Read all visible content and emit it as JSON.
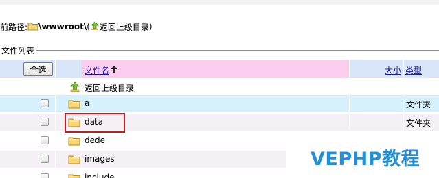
{
  "path_bar": {
    "prefix": "前路径:",
    "path": "\\wwwroot\\",
    "paren_open": "(",
    "up_link": "返回上级目录",
    "paren_close": ")"
  },
  "file_list": {
    "legend": "文件列表",
    "header": {
      "select_all": "全选",
      "name": "文件名",
      "size": "大小",
      "type": "类型"
    },
    "up_row": {
      "label": "返回上级目录"
    },
    "rows": [
      {
        "name": "a",
        "type": "文件夹"
      },
      {
        "name": "data",
        "type": "文件夹"
      },
      {
        "name": "dede",
        "type": ""
      },
      {
        "name": "images",
        "type": ""
      },
      {
        "name": "include",
        "type": ""
      }
    ]
  },
  "watermark": {
    "text": "VEPHP教程"
  },
  "colors": {
    "header_blue": "#d9e5f8",
    "header_pink": "#fccdee",
    "row_highlight": "#d6f1fc",
    "row_alt": "#f5f0f5",
    "highlight_box": "#c81a1a",
    "watermark": "#2390d6"
  }
}
